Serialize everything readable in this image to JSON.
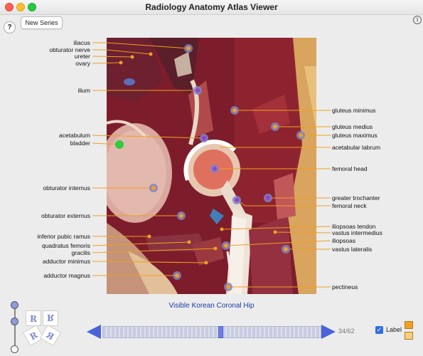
{
  "window": {
    "title": "Radiology Anatomy Atlas Viewer"
  },
  "toolbar": {
    "help_label": "?",
    "new_series_label": "New Series",
    "info_label": "i"
  },
  "viewer": {
    "caption": "Visible Korean Coronal Hip",
    "left_labels": [
      "iliacus",
      "obturator nerve",
      "ureter",
      "ovary",
      "ilium",
      "acetabulum",
      "bladder",
      "obturator internus",
      "obturator externus",
      "inferior pubic ramus",
      "quadratus femoris",
      "gracilis",
      "adductor minimus",
      "adductor magnus"
    ],
    "right_labels": [
      "gluteus minimus",
      "gluteus medius",
      "gluteus maximus",
      "acetabular labrum",
      "femoral head",
      "greater trochanter",
      "femoral neck",
      "iliopsoas tendon",
      "vastus intermedius",
      "iliopsoas",
      "vastus lateralis",
      "pectineus"
    ]
  },
  "navigation": {
    "slice_counter": "34/62",
    "slice_current": 34,
    "slice_total": 62,
    "label_toggle_text": "Label",
    "label_toggle_checked": true,
    "checkbox_glyph": "✓",
    "thumb_glyphs": [
      "R",
      "R",
      "R",
      "R"
    ]
  },
  "colors": {
    "accent": "#4a63d8",
    "leader_line": "#f0a020",
    "swatch_primary": "#f0a020",
    "swatch_secondary": "#f6d080",
    "caption": "#1a3ca8"
  }
}
